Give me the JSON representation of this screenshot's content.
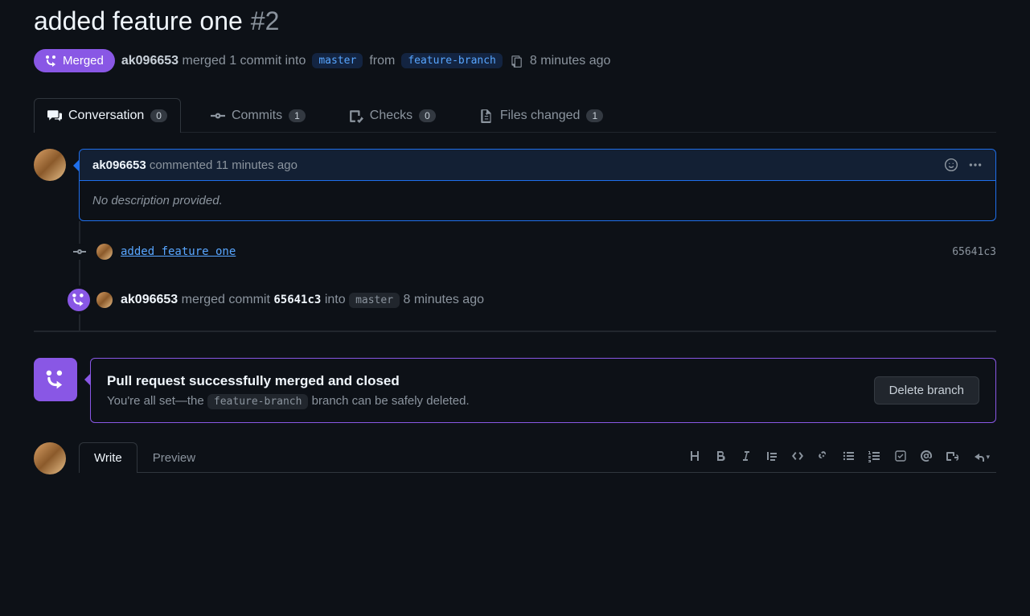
{
  "title": "added feature one",
  "issue_number": "#2",
  "state": {
    "label": "Merged"
  },
  "meta": {
    "author": "ak096653",
    "merged_text_prefix": "merged 1 commit into",
    "base_branch": "master",
    "from_word": "from",
    "head_branch": "feature-branch",
    "relative_time": "8 minutes ago"
  },
  "tabs": [
    {
      "label": "Conversation",
      "count": "0"
    },
    {
      "label": "Commits",
      "count": "1"
    },
    {
      "label": "Checks",
      "count": "0"
    },
    {
      "label": "Files changed",
      "count": "1"
    }
  ],
  "comment": {
    "author": "ak096653",
    "action": "commented",
    "relative_time": "11 minutes ago",
    "body": "No description provided."
  },
  "commit_event": {
    "message": "added feature one",
    "sha_short": "65641c3"
  },
  "merge_event": {
    "author": "ak096653",
    "text_prefix": "merged commit",
    "sha_short": "65641c3",
    "into_word": "into",
    "branch": "master",
    "relative_time": "8 minutes ago"
  },
  "merged_panel": {
    "title": "Pull request successfully merged and closed",
    "desc_prefix": "You're all set—the",
    "branch": "feature-branch",
    "desc_suffix": "branch can be safely deleted.",
    "delete_button": "Delete branch"
  },
  "editor": {
    "tabs": {
      "write": "Write",
      "preview": "Preview"
    }
  }
}
